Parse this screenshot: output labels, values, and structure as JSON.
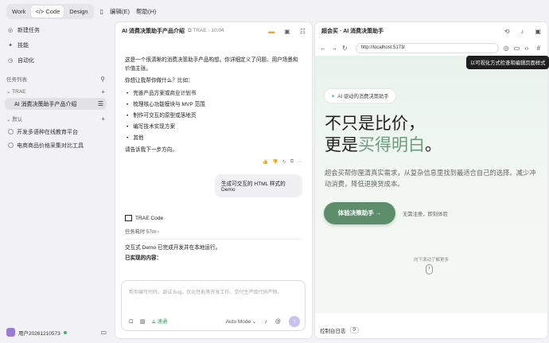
{
  "topbar": {
    "modes": [
      "Work",
      "Code",
      "Design"
    ],
    "active_mode": "Code",
    "sidebar_toggle_icon": "sidebar-icon",
    "menus": [
      "编辑(E)",
      "帮助(H)"
    ]
  },
  "sidebar": {
    "items": [
      {
        "label": "新建任务",
        "icon": "chat-plus-icon"
      },
      {
        "label": "技能",
        "icon": "skill-icon"
      },
      {
        "label": "自动化",
        "icon": "automation-icon"
      }
    ],
    "task_list_label": "任务列表",
    "groups": [
      {
        "name": "TRAE",
        "tasks": [
          {
            "label": "AI 消费决策助手产品介绍",
            "active": true
          }
        ]
      },
      {
        "name": "默认",
        "tasks": []
      }
    ],
    "other_tasks": [
      "开发多语种在线教育平台",
      "电商商品价格采集对比工具"
    ],
    "user_name": "用户20261210573"
  },
  "chat": {
    "title": "AI 消费决策助手产品介绍",
    "meta": "TRAE · 10:04",
    "intro": "这是一个很清晰的消费决策助手产品构想。你详细定义了问题、用户场景和价值主张。",
    "question": "你想让我帮你做什么？比如：",
    "options": [
      "完善产品方案或商业计划书",
      "梳理核心功能模块与 MVP 范围",
      "制作可交互的原型或落地页",
      "编写技术实现方案",
      "其他"
    ],
    "closing": "请告诉我下一步方向。",
    "user_message": "生成可交互的 HTML 样式的 Demo",
    "agent_name": "TRAE Code",
    "elapsed": "任务耗时 57m",
    "status": "交互式 Demo 已完成开发并在本地运行。",
    "implemented_label": "已实现的内容：",
    "input_placeholder": "帮你编写代码，调试 Bug，优化性能等开发工作。交付生产级代码产物。",
    "quick_label": "速通",
    "mode_label": "Auto Mode"
  },
  "preview": {
    "title": "超会买 · AI 消费决策助手",
    "url": "http://localhost:5173/",
    "tooltip": "以可视化方式检查和编辑页面样式",
    "badge": "AI 驱动的消费决策助手",
    "hero_line1": "不只是比价，",
    "hero_line2_plain": "更是",
    "hero_line2_accent": "买得明白",
    "hero_line2_end": "。",
    "subtitle": "超会买帮你厘清真实需求，从复杂信息里找到最适合自己的选择。减少冲动消费，降低退换货成本。",
    "cta": "体验决策助手 →",
    "cta_secondary": "无需注册，即刻体验",
    "scroll_hint": "向下滚动了解更多",
    "console_label": "控制台日志",
    "console_count": "0",
    "accent_color": "#5d8e6c"
  }
}
